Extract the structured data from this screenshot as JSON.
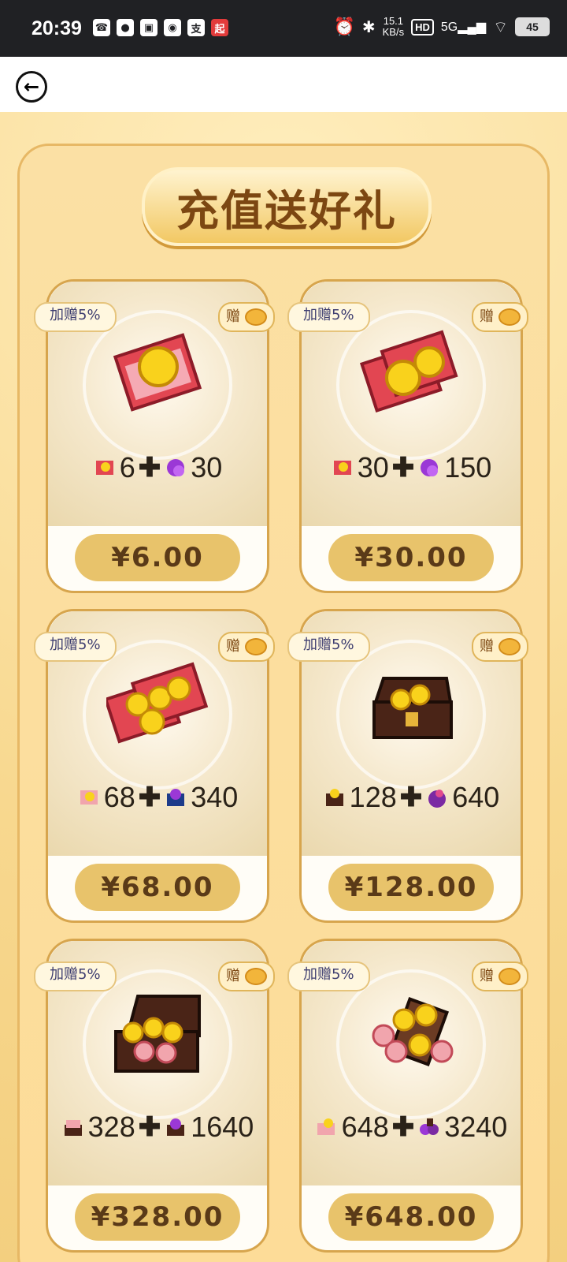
{
  "status_bar": {
    "time": "20:39",
    "speed_value": "15.1",
    "speed_unit": "KB/s",
    "battery": "45",
    "left_icons": [
      "call-icon",
      "message-icon",
      "app-icon",
      "qq-icon",
      "alipay-icon",
      "qidian-icon"
    ],
    "right_icons": [
      "alarm-icon",
      "bluetooth-icon",
      "hd-icon",
      "signal-icon",
      "wifi-icon",
      "battery-icon"
    ]
  },
  "nav": {
    "back_icon": "back-arrow-icon"
  },
  "banner": {
    "title": "充值送好礼"
  },
  "cards": [
    {
      "bonus": "加赠5%",
      "gift_label": "赠",
      "reward_a": "6",
      "reward_b": "30",
      "price": "¥6.00",
      "art": "red-envelope-coin"
    },
    {
      "bonus": "加赠5%",
      "gift_label": "赠",
      "reward_a": "30",
      "reward_b": "150",
      "price": "¥30.00",
      "art": "red-envelopes-coins"
    },
    {
      "bonus": "加赠5%",
      "gift_label": "赠",
      "reward_a": "68",
      "reward_b": "340",
      "price": "¥68.00",
      "art": "many-envelopes"
    },
    {
      "bonus": "加赠5%",
      "gift_label": "赠",
      "reward_a": "128",
      "reward_b": "640",
      "price": "¥128.00",
      "art": "chest-small"
    },
    {
      "bonus": "加赠5%",
      "gift_label": "赠",
      "reward_a": "328",
      "reward_b": "1640",
      "price": "¥328.00",
      "art": "chest-large"
    },
    {
      "bonus": "加赠5%",
      "gift_label": "赠",
      "reward_a": "648",
      "reward_b": "3240",
      "price": "¥648.00",
      "art": "chest-overflow"
    }
  ],
  "colors": {
    "background": "#fbe3ae",
    "price_button": "#e8c36b",
    "banner_text": "#7c4712",
    "card_border": "#d7a54d"
  }
}
